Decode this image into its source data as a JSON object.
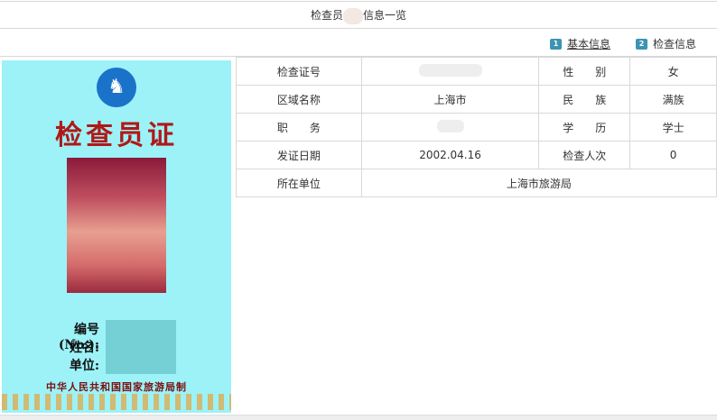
{
  "title": {
    "prefix": "检查员",
    "suffix": "信息一览"
  },
  "tabs": [
    {
      "num": "1",
      "label": "基本信息"
    },
    {
      "num": "2",
      "label": "检查信息"
    }
  ],
  "card": {
    "title": "检查员证",
    "labels": [
      "编号(No.):",
      "姓名:",
      "单位:"
    ],
    "issuer": "中华人民共和国国家旅游局制"
  },
  "info": {
    "cert_no_label": "检查证号",
    "gender_label": "性　　别",
    "gender": "女",
    "region_label": "区域名称",
    "region": "上海市",
    "ethnic_label": "民　　族",
    "ethnic": "满族",
    "post_label": "职　　务",
    "edu_label": "学　　历",
    "edu": "学士",
    "issue_date_label": "发证日期",
    "issue_date": "2002.04.16",
    "count_label": "检查人次",
    "count": "0",
    "unit_label": "所在单位",
    "unit": "上海市旅游局"
  }
}
